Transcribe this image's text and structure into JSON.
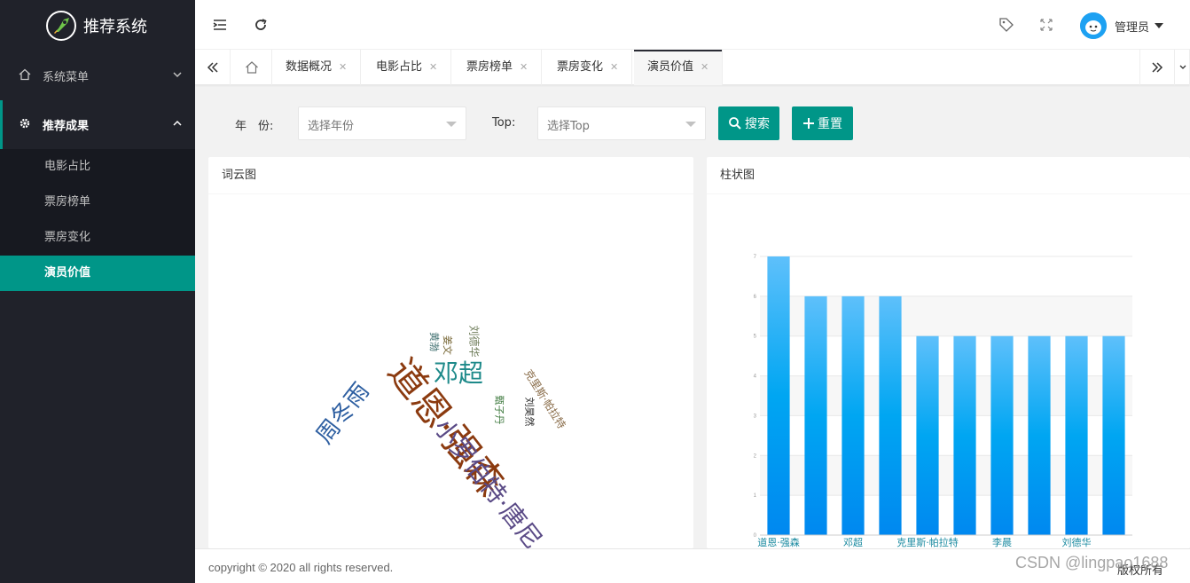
{
  "app": {
    "title": "推荐系统"
  },
  "sidebar": {
    "items": [
      {
        "label": "系统菜单",
        "icon": "home-icon"
      },
      {
        "label": "推荐成果",
        "icon": "gear-icon"
      }
    ],
    "sub_items": [
      {
        "label": "电影占比"
      },
      {
        "label": "票房榜单"
      },
      {
        "label": "票房变化"
      },
      {
        "label": "演员价值",
        "active": true
      }
    ]
  },
  "header": {
    "user_name": "管理员"
  },
  "tabs": [
    {
      "label": "数据概况"
    },
    {
      "label": "电影占比"
    },
    {
      "label": "票房榜单"
    },
    {
      "label": "票房变化"
    },
    {
      "label": "演员价值",
      "active": true
    }
  ],
  "search": {
    "year_label": "年　份:",
    "year_placeholder": "选择年份",
    "top_label": "Top:",
    "top_placeholder": "选择Top",
    "search_button": "搜索",
    "reset_button": "重置"
  },
  "cards": {
    "wordcloud_title": "词云图",
    "bar_title": "柱状图"
  },
  "wordcloud": [
    {
      "text": "道恩·强森",
      "size": 42,
      "color": "#8b3a0f"
    },
    {
      "text": "小罗伯特·唐尼",
      "size": 28,
      "color": "#5a4a86"
    },
    {
      "text": "周冬雨",
      "size": 26,
      "color": "#2e5fa1"
    },
    {
      "text": "邓超",
      "size": 28,
      "color": "#1e8a8a"
    },
    {
      "text": "克里斯·帕拉特",
      "size": 12,
      "color": "#8a6d4a"
    },
    {
      "text": "刘德华",
      "size": 12,
      "color": "#6f7d5a"
    },
    {
      "text": "姜文",
      "size": 11,
      "color": "#7a6a3a"
    },
    {
      "text": "黄渤",
      "size": 11,
      "color": "#3f6f6f"
    },
    {
      "text": "甄子丹",
      "size": 11,
      "color": "#3e7a3e"
    },
    {
      "text": "刘昊然",
      "size": 11,
      "color": "#2a2a2a"
    }
  ],
  "chart_data": {
    "type": "bar",
    "categories": [
      "道恩·强森",
      "",
      "邓超",
      "",
      "克里斯·帕拉特",
      "",
      "李晨",
      "",
      "刘德华",
      ""
    ],
    "values": [
      7,
      6,
      6,
      6,
      5,
      5,
      5,
      5,
      5,
      5
    ],
    "ylim": [
      0,
      7
    ],
    "yticks": [
      0,
      1,
      2,
      3,
      4,
      5,
      6,
      7
    ],
    "grid": true,
    "colors": {
      "top": "#5ec0fb",
      "mid": "#00a6f2",
      "bottom": "#0088f0"
    }
  },
  "footer": {
    "copyright": "copyright © 2020 all rights reserved.",
    "rights": "版权所有",
    "watermark": "CSDN @lingpao1688"
  }
}
